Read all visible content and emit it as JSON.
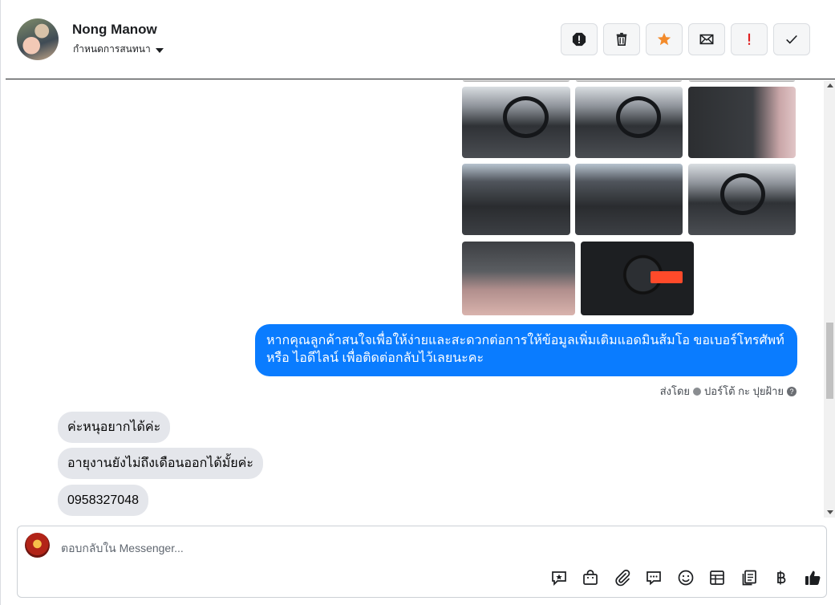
{
  "header": {
    "name": "Nong Manow",
    "assign_label": "กำหนดการสนทนา",
    "tools": [
      {
        "name": "mark-spam-button",
        "icon": "alert-octagon-icon"
      },
      {
        "name": "delete-button",
        "icon": "trash-icon"
      },
      {
        "name": "star-button",
        "icon": "star-icon",
        "color": "#f38b2b"
      },
      {
        "name": "mark-unread-button",
        "icon": "envelope-icon"
      },
      {
        "name": "follow-up-button",
        "icon": "exclamation-icon",
        "color": "#e02020"
      },
      {
        "name": "mark-done-button",
        "icon": "check-icon"
      }
    ]
  },
  "messages": {
    "outgoing_text": "หากคุณลูกค้าสนใจเพื่อให้ง่ายและสะดวกต่อการให้ข้อมูลเพิ่มเติมแอดมินส้มโอ ขอเบอร์โทรศัพท์ หรือ ไอดีไลน์ เพื่อติดต่อกลับไว้เลยนะคะ",
    "sent_by_prefix": "ส่งโดย",
    "sent_by_name": "ปอร์โต้ กะ ปุยฝ้าย",
    "incoming": [
      "ค่ะหนุอยากได้ค่ะ",
      "อายุงานยังไม่ถึงเดือนออกได้มั้ยค่ะ",
      "0958327048"
    ],
    "outgoing_color": "#0a7cff"
  },
  "composer": {
    "placeholder": "ตอบกลับใน Messenger...",
    "tools": [
      "saved-reply-icon",
      "shopping-bag-icon",
      "attachment-icon",
      "chat-bubbles-icon",
      "emoji-icon",
      "table-icon",
      "document-icon",
      "baht-icon",
      "thumbs-up-icon"
    ]
  }
}
